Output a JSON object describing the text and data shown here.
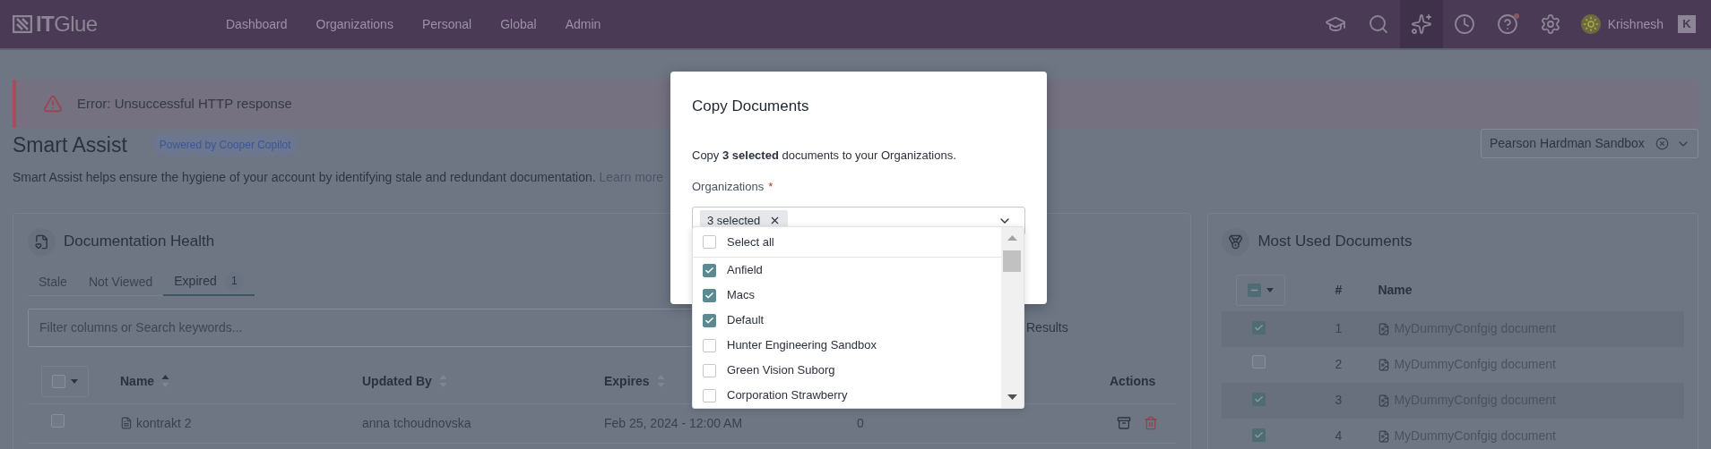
{
  "header": {
    "logo": "**IT**Glue",
    "nav": [
      {
        "label": "Dashboard"
      },
      {
        "label": "Organizations"
      },
      {
        "label": "Personal"
      },
      {
        "label": "Global"
      },
      {
        "label": "Admin"
      }
    ],
    "toolbar": [
      {
        "kind": "training",
        "selected": false,
        "notification": false
      },
      {
        "kind": "search",
        "selected": false,
        "notification": false
      },
      {
        "kind": "assist",
        "selected": true,
        "notification": false
      },
      {
        "kind": "history",
        "selected": false,
        "notification": false
      },
      {
        "kind": "help",
        "selected": false,
        "notification": true
      },
      {
        "kind": "settings",
        "selected": false,
        "notification": false
      }
    ],
    "user": {
      "name": "Krishnesh"
    },
    "account": {
      "initial": "K"
    }
  },
  "error_banner": {
    "message": "Error: Unsuccessful HTTP response"
  },
  "page": {
    "title": "Smart Assist",
    "badge": "Powered by Cooper Copilot",
    "description": "Smart Assist helps ensure the hygiene of your account by identifying stale and redundant documentation.",
    "learn_more": "Learn more"
  },
  "org_picker": {
    "value": "Pearson Hardman Sandbox"
  },
  "documentation_health": {
    "title": "Documentation Health",
    "tabs": [
      {
        "label": "Stale",
        "selected": false
      },
      {
        "label": "Not Viewed",
        "selected": false
      },
      {
        "label": "Expired",
        "count": "1",
        "selected": true
      }
    ],
    "search": {
      "placeholder": "Filter columns or Search keywords..."
    },
    "results": "Results",
    "header_checkbox": {
      "checked": false
    },
    "columns": [
      {
        "label": "Name",
        "sorted_ascending": true
      },
      {
        "label": "Updated By",
        "sorted_ascending": false
      },
      {
        "label": "Expires",
        "sorted_ascending": false
      },
      {
        "label": "Actions"
      }
    ],
    "rows": [
      {
        "checked": false,
        "name": "kontrakt 2",
        "updated_by": "anna tchoudnovska",
        "expires": "Feb 25, 2024 - 12:00 AM",
        "column_4": "0"
      }
    ]
  },
  "most_used": {
    "title": "Most Used Documents",
    "header_checkbox": {
      "indeterminate": true
    },
    "columns": [
      {
        "label": "#"
      },
      {
        "label": "Name"
      }
    ],
    "rows": [
      {
        "checked": true,
        "number": "1",
        "name": "MyDummyConfgig document"
      },
      {
        "checked": false,
        "number": "2",
        "name": "MyDummyConfgig document"
      },
      {
        "checked": true,
        "number": "3",
        "name": "MyDummyConfgig document"
      },
      {
        "checked": true,
        "number": "4",
        "name": "MyDummyConfgig document"
      }
    ]
  },
  "modal": {
    "title": "Copy Documents",
    "message": "Copy **3 selected** documents to your Organizations.",
    "field_label": "Organizations",
    "required_mark": "*",
    "chip": "3 selected",
    "select_all": {
      "label": "Select all",
      "checked": false
    },
    "options": [
      {
        "label": "Anfield",
        "checked": true
      },
      {
        "label": "Macs",
        "checked": true
      },
      {
        "label": "Default",
        "checked": true
      },
      {
        "label": "Hunter Engineering Sandbox",
        "checked": false
      },
      {
        "label": "Green Vision Suborg",
        "checked": false
      },
      {
        "label": "Corporation Strawberry",
        "checked": false
      }
    ]
  }
}
